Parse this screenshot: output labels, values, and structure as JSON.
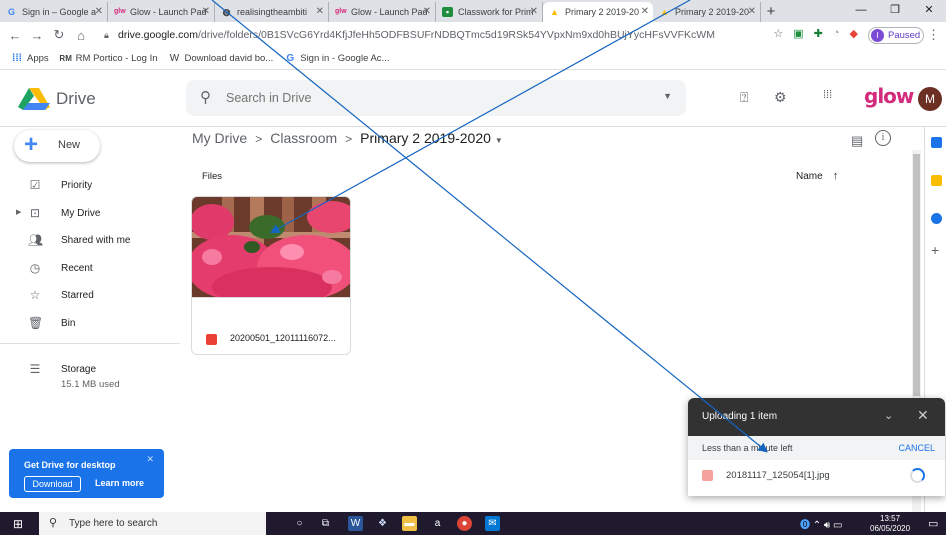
{
  "browser": {
    "tabs": [
      {
        "icon": "google-icon",
        "label": "Sign in – Google a",
        "active": false
      },
      {
        "icon": "glow-icon",
        "label": "Glow - Launch Pad",
        "active": false
      },
      {
        "icon": "web-icon",
        "label": "realisingtheambiti",
        "active": false
      },
      {
        "icon": "glow-icon",
        "label": "Glow - Launch Pad",
        "active": false
      },
      {
        "icon": "classroom-icon",
        "label": "Classwork for Prim",
        "active": false
      },
      {
        "icon": "drive-icon",
        "label": "Primary 2 2019-20",
        "active": true
      },
      {
        "icon": "drive-icon",
        "label": "Primary 2 2019-20",
        "active": false
      }
    ],
    "url_host": "drive.google.com",
    "url_path": "/drive/folders/0B1SVcG6Yrd4KfjJfeHh5ODFBSUFrNDBQTmc5d19RSk54YVpxNm9xd0hBUjYycHFsVVFKcWM",
    "profile_initial": "I",
    "profile_status": "Paused",
    "bookmarks": [
      {
        "icon": "apps-icon",
        "label": "Apps"
      },
      {
        "icon": "rm-icon",
        "label": "RM Portico - Log In"
      },
      {
        "icon": "w-icon",
        "label": "Download david bo..."
      },
      {
        "icon": "google-icon",
        "label": "Sign in - Google Ac..."
      }
    ]
  },
  "header": {
    "app_name": "Drive",
    "search_placeholder": "Search in Drive",
    "brand": "glow",
    "avatar_initial": "M"
  },
  "sidebar": {
    "new_label": "New",
    "items": [
      {
        "icon": "priority-icon",
        "label": "Priority"
      },
      {
        "icon": "my-drive-icon",
        "label": "My Drive"
      },
      {
        "icon": "shared-icon",
        "label": "Shared with me"
      },
      {
        "icon": "recent-icon",
        "label": "Recent"
      },
      {
        "icon": "star-icon",
        "label": "Starred"
      },
      {
        "icon": "bin-icon",
        "label": "Bin"
      },
      {
        "icon": "storage-icon",
        "label": "Storage"
      }
    ],
    "storage_used": "15.1 MB used",
    "promo": {
      "title": "Get Drive for desktop",
      "download": "Download",
      "learn_more": "Learn more"
    }
  },
  "main": {
    "breadcrumb": [
      "My Drive",
      "Classroom",
      "Primary 2 2019-2020"
    ],
    "section": "Files",
    "sort_label": "Name",
    "files": [
      {
        "name": "20200501_12011116072..."
      }
    ]
  },
  "upload": {
    "title": "Uploading 1 item",
    "status": "Less than a minute left",
    "cancel": "CANCEL",
    "file": "20181117_125054[1].jpg"
  },
  "taskbar": {
    "search_placeholder": "Type here to search",
    "time": "13:57",
    "date": "06/05/2020"
  },
  "colors": {
    "accent": "#1a73e8",
    "glow": "#d42a7b",
    "annotation_arrow": "#1565c0"
  }
}
